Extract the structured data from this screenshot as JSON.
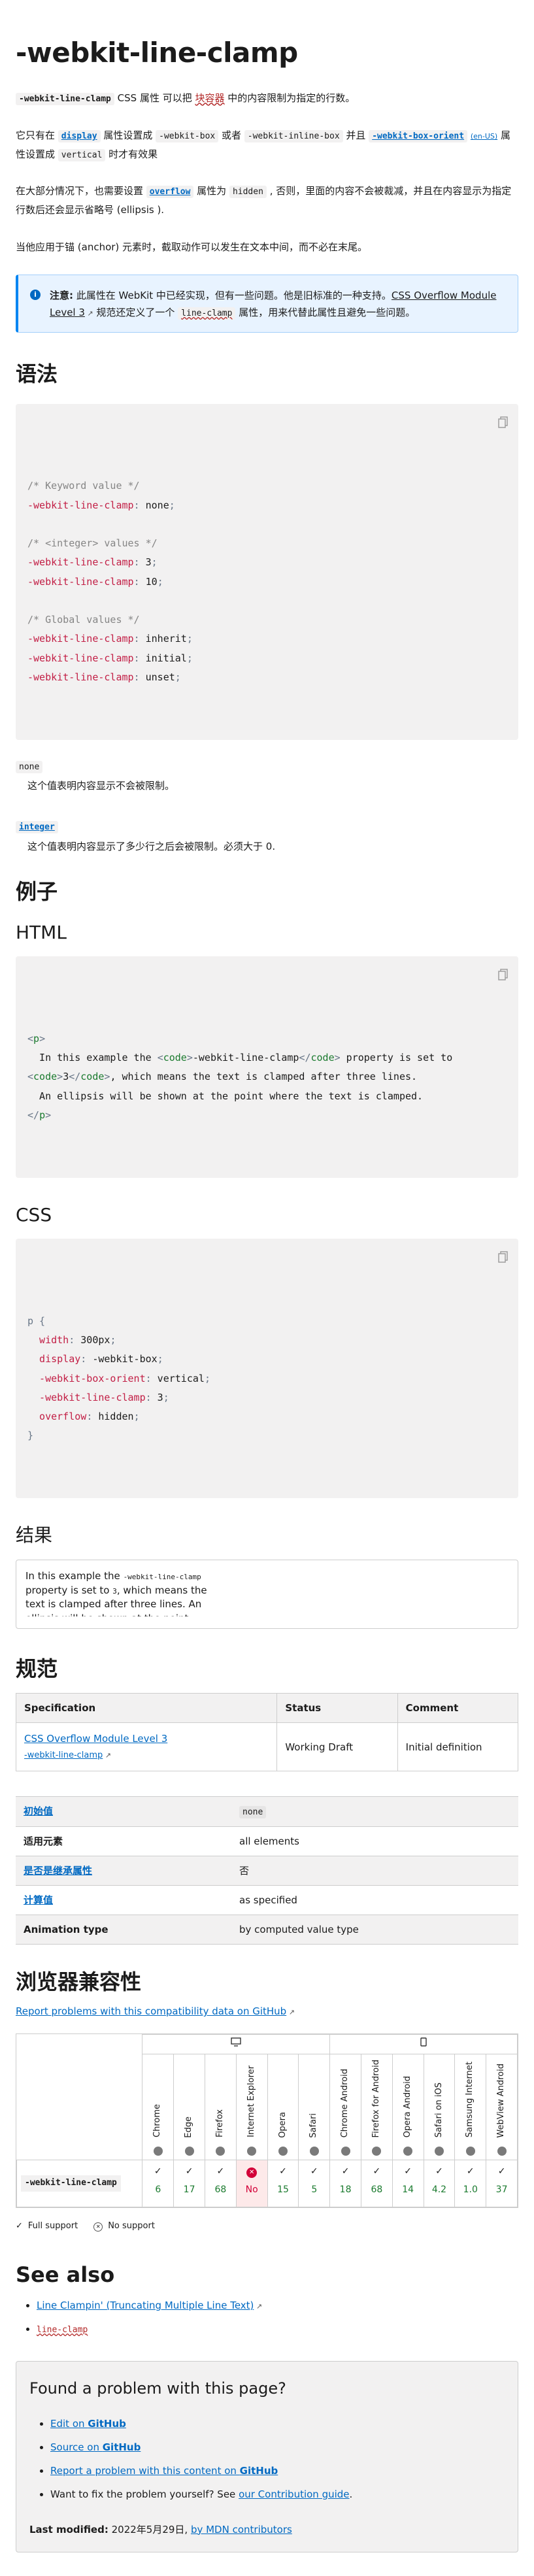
{
  "title": "-webkit-line-clamp",
  "intro": {
    "p1_code": "-webkit-line-clamp",
    "p1_t1": " CSS 属性 可以把 ",
    "p1_wavy": "块容器",
    "p1_t2": " 中的内容限制为指定的行数。",
    "p2_t1": "它只有在 ",
    "p2_link1": "display",
    "p2_t2": " 属性设置成 ",
    "p2_code1": "-webkit-box",
    "p2_t3": " 或者 ",
    "p2_code2": "-webkit-inline-box",
    "p2_t4": " 并且 ",
    "p2_link2": "-webkit-box-orient",
    "p2_sup": "(en-US)",
    "p2_t5": " 属性设置成 ",
    "p2_code3": "vertical",
    "p2_t6": " 时才有效果",
    "p3_t1": "在大部分情况下，也需要设置 ",
    "p3_link": "overflow",
    "p3_t2": " 属性为 ",
    "p3_code": "hidden",
    "p3_t3": " , 否则，里面的内容不会被裁减，并且在内容显示为指定行数后还会显示省略号 (ellipsis ).",
    "p4": "当他应用于锚 (anchor) 元素时，截取动作可以发生在文本中间，而不必在末尾。"
  },
  "note": {
    "bold": "注意:",
    "t1": " 此属性在 WebKit 中已经实现，但有一些问题。他是旧标准的一种支持。",
    "link": "CSS Overflow Module Level 3",
    "t2": " 规范还定义了一个 ",
    "wavy": "line-clamp",
    "t3": " 属性，用来代替此属性且避免一些问题。"
  },
  "syntax": {
    "heading": "语法",
    "lines": [
      "/* Keyword value */",
      "-webkit-line-clamp: none;",
      "",
      "/* <integer> values */",
      "-webkit-line-clamp: 3;",
      "-webkit-line-clamp: 10;",
      "",
      "/* Global values */",
      "-webkit-line-clamp: inherit;",
      "-webkit-line-clamp: initial;",
      "-webkit-line-clamp: unset;"
    ],
    "values": [
      {
        "term": "none",
        "desc": "这个值表明内容显示不会被限制。",
        "link": false
      },
      {
        "term": "integer",
        "desc": "这个值表明内容显示了多少行之后会被限制。必须大于 0.",
        "link": true
      }
    ]
  },
  "examples": {
    "heading": "例子",
    "html_heading": "HTML",
    "css_heading": "CSS",
    "result_heading": "结果",
    "html_lines": [
      "<p>",
      "  In this example the <code>-webkit-line-clamp</code> property is set to",
      "<code>3</code>, which means the text is clamped after three lines.",
      "  An ellipsis will be shown at the point where the text is clamped.",
      "</p>"
    ],
    "css_lines": [
      "p {",
      "  width: 300px;",
      "  display: -webkit-box;",
      "  -webkit-box-orient: vertical;",
      "  -webkit-line-clamp: 3;",
      "  overflow: hidden;",
      "}"
    ],
    "result_t1": "In this example the ",
    "result_code1": "-webkit-line-clamp",
    "result_t2": " property is set to ",
    "result_code2": "3",
    "result_t3": ", which means the text is clamped after three lines. An ellipsis will be shown at the point where the text is clamped."
  },
  "spec": {
    "heading": "规范",
    "headers": [
      "Specification",
      "Status",
      "Comment"
    ],
    "link": "CSS Overflow Module Level 3",
    "sublink": "-webkit-line-clamp",
    "status": "Working Draft",
    "comment": "Initial definition"
  },
  "props": [
    {
      "key": "初始值",
      "value": "none",
      "link": true,
      "code": true
    },
    {
      "key": "适用元素",
      "value": "all elements",
      "link": false,
      "code": false
    },
    {
      "key": "是否是继承属性",
      "value": "否",
      "link": true,
      "code": false
    },
    {
      "key": "计算值",
      "value": "as specified",
      "link": true,
      "code": false
    },
    {
      "key": "Animation type",
      "value": "by computed value type",
      "link": false,
      "code": false
    }
  ],
  "compat": {
    "heading": "浏览器兼容性",
    "report_link": "Report problems with this compatibility data on GitHub",
    "feature": "-webkit-line-clamp",
    "browsers": [
      {
        "name": "Chrome",
        "version": "6",
        "supported": true
      },
      {
        "name": "Edge",
        "version": "17",
        "supported": true
      },
      {
        "name": "Firefox",
        "version": "68",
        "supported": true
      },
      {
        "name": "Internet Explorer",
        "version": "No",
        "supported": false
      },
      {
        "name": "Opera",
        "version": "15",
        "supported": true
      },
      {
        "name": "Safari",
        "version": "5",
        "supported": true
      },
      {
        "name": "Chrome Android",
        "version": "18",
        "supported": true
      },
      {
        "name": "Firefox for Android",
        "version": "68",
        "supported": true
      },
      {
        "name": "Opera Android",
        "version": "14",
        "supported": true
      },
      {
        "name": "Safari on iOS",
        "version": "4.2",
        "supported": true
      },
      {
        "name": "Samsung Internet",
        "version": "1.0",
        "supported": true
      },
      {
        "name": "WebView Android",
        "version": "37",
        "supported": true
      }
    ],
    "legend_full": "Full support",
    "legend_no": "No support",
    "colors": {
      "yes": "#1a7a2e",
      "no": "#d30038"
    }
  },
  "seealso": {
    "heading": "See also",
    "items": [
      "Line Clampin' (Truncating Multiple Line Text)",
      "line-clamp"
    ]
  },
  "problem": {
    "heading": "Found a problem with this page?",
    "edit_t": "Edit on ",
    "edit_b": "GitHub",
    "source_t": "Source on ",
    "source_b": "GitHub",
    "report_t": "Report a problem with this content on ",
    "report_b": "GitHub",
    "fix_t": "Want to fix the problem yourself? See ",
    "fix_link": "our Contribution guide",
    "fix_end": ".",
    "lm_label": "Last modified:",
    "lm_date": " 2022年5月29日, ",
    "lm_link": "by MDN contributors"
  }
}
